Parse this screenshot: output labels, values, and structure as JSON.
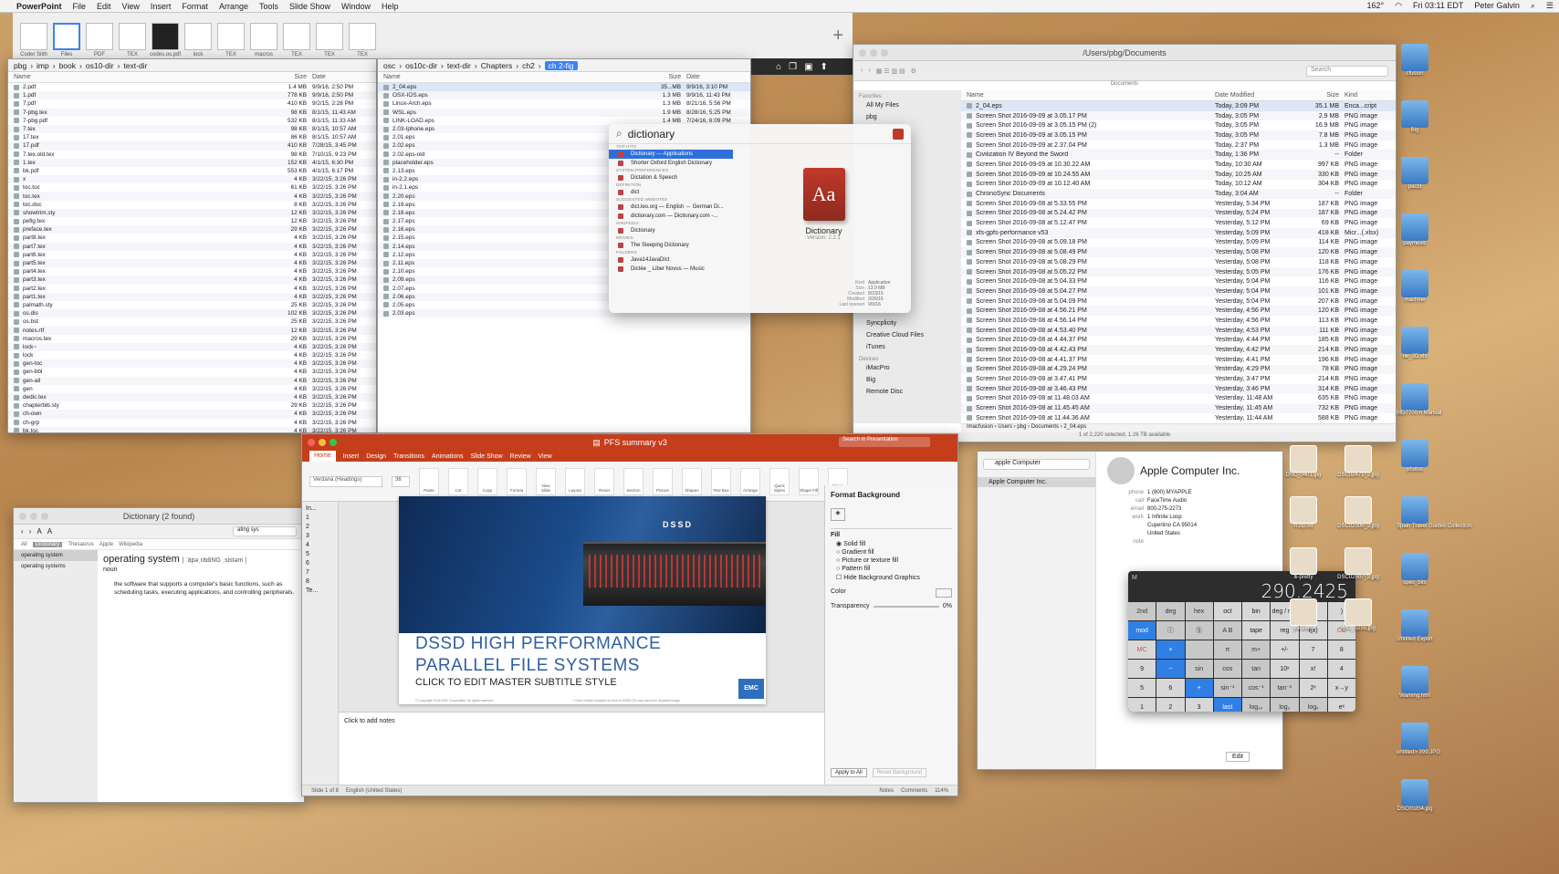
{
  "menubar": {
    "app": "PowerPoint",
    "items": [
      "File",
      "Edit",
      "View",
      "Insert",
      "Format",
      "Arrange",
      "Tools",
      "Slide Show",
      "Window",
      "Help"
    ],
    "status": "162°",
    "clock": "Fri 03:11 EDT",
    "user": "Peter Galvin"
  },
  "thumbs": [
    {
      "label": "Coder Slith",
      "cls": ""
    },
    {
      "label": "Files",
      "cls": "sel"
    },
    {
      "label": "PDF",
      "cls": ""
    },
    {
      "label": "TEX",
      "cls": ""
    },
    {
      "label": "codes.os.pdf",
      "cls": "dark"
    },
    {
      "label": "lock",
      "cls": ""
    },
    {
      "label": "TEX",
      "cls": ""
    },
    {
      "label": "macros",
      "cls": ""
    },
    {
      "label": "TEX",
      "cls": ""
    },
    {
      "label": "TEX",
      "cls": ""
    },
    {
      "label": "TEX",
      "cls": ""
    }
  ],
  "finder_left": {
    "path": [
      "pbg",
      "imp",
      "book",
      "os10-dir",
      "text-dir"
    ],
    "cols": {
      "name": "Name",
      "size": "Size",
      "date": "Date"
    },
    "rows": [
      [
        "2.pdf",
        "1.4 MB",
        "9/9/16, 2:50 PM"
      ],
      [
        "1.pdf",
        "778 KB",
        "9/9/16, 2:50 PM"
      ],
      [
        "7.pdf",
        "410 KB",
        "9/2/15, 2:28 PM"
      ],
      [
        "7-pbg.tex",
        "98 KB",
        "8/1/15, 11:43 AM"
      ],
      [
        "7-pbg.pdf",
        "532 KB",
        "8/1/15, 11:33 AM"
      ],
      [
        "7.tex",
        "98 KB",
        "8/1/15, 10:57 AM"
      ],
      [
        "17.tex",
        "86 KB",
        "8/1/15, 10:57 AM"
      ],
      [
        "17.pdf",
        "410 KB",
        "7/28/15, 3:45 PM"
      ],
      [
        "7.tex.old.tex",
        "98 KB",
        "7/10/15, 9:23 PM"
      ],
      [
        "1.tex",
        "152 KB",
        "4/1/15, 6:30 PM"
      ],
      [
        "bk.pdf",
        "553 KB",
        "4/1/15, 6:17 PM"
      ],
      [
        "x",
        "4 KB",
        "3/22/15, 3:26 PM"
      ],
      [
        "toc.toc",
        "61 KB",
        "3/22/15, 3:26 PM"
      ],
      [
        "toc.tex",
        "4 KB",
        "3/22/15, 3:26 PM"
      ],
      [
        "toc.doc",
        "8 KB",
        "3/22/15, 3:26 PM"
      ],
      [
        "showtrim.sty",
        "12 KB",
        "3/22/15, 3:26 PM"
      ],
      [
        "pefig.tex",
        "12 KB",
        "3/22/15, 3:26 PM"
      ],
      [
        "preface.tex",
        "29 KB",
        "3/22/15, 3:26 PM"
      ],
      [
        "part8.tex",
        "4 KB",
        "3/22/15, 3:26 PM"
      ],
      [
        "part7.tex",
        "4 KB",
        "3/22/15, 3:26 PM"
      ],
      [
        "part6.tex",
        "4 KB",
        "3/22/15, 3:26 PM"
      ],
      [
        "part5.tex",
        "4 KB",
        "3/22/15, 3:26 PM"
      ],
      [
        "part4.tex",
        "4 KB",
        "3/22/15, 3:26 PM"
      ],
      [
        "part3.tex",
        "4 KB",
        "3/22/15, 3:26 PM"
      ],
      [
        "part2.tex",
        "4 KB",
        "3/22/15, 3:26 PM"
      ],
      [
        "part1.tex",
        "4 KB",
        "3/22/15, 3:26 PM"
      ],
      [
        "palmath.sty",
        "25 KB",
        "3/22/15, 3:26 PM"
      ],
      [
        "os.dis",
        "102 KB",
        "3/22/15, 3:26 PM"
      ],
      [
        "os.bst",
        "25 KB",
        "3/22/15, 3:26 PM"
      ],
      [
        "notes.rtf",
        "12 KB",
        "3/22/15, 3:26 PM"
      ],
      [
        "macros.tex",
        "29 KB",
        "3/22/15, 3:26 PM"
      ],
      [
        "lock~",
        "4 KB",
        "3/22/15, 3:26 PM"
      ],
      [
        "lock",
        "4 KB",
        "3/22/15, 3:26 PM"
      ],
      [
        "gen-toc",
        "4 KB",
        "3/22/15, 3:26 PM"
      ],
      [
        "gen-bbl",
        "4 KB",
        "3/22/15, 3:26 PM"
      ],
      [
        "gen-all",
        "4 KB",
        "3/22/15, 3:26 PM"
      ],
      [
        "gen",
        "4 KB",
        "3/22/15, 3:26 PM"
      ],
      [
        "dedic.tex",
        "4 KB",
        "3/22/15, 3:26 PM"
      ],
      [
        "chapterbib.sty",
        "29 KB",
        "3/22/15, 3:26 PM"
      ],
      [
        "ch-own",
        "4 KB",
        "3/22/15, 3:26 PM"
      ],
      [
        "ch-grp",
        "4 KB",
        "3/22/15, 3:26 PM"
      ],
      [
        "bk.toc",
        "4 KB",
        "3/22/15, 3:26 PM"
      ],
      [
        "bk.tex",
        "86 KB",
        "3/22/15, 3:26 PM"
      ]
    ]
  },
  "finder_mid": {
    "path": [
      "osc",
      "os10c-dir",
      "text-dir",
      "Chapters",
      "ch2",
      "ch 2-fig"
    ],
    "cols": {
      "name": "Name",
      "size": "Size",
      "date": "Date"
    },
    "rows": [
      [
        "2_04.eps",
        "35...MB",
        "9/9/16, 3:10 PM"
      ],
      [
        "OSX-IOS.eps",
        "1.3 MB",
        "9/9/16, 11:43 PM"
      ],
      [
        "Linux-Arch.eps",
        "1.3 MB",
        "8/21/16, 5:56 PM"
      ],
      [
        "WSL.eps",
        "1.9 MB",
        "8/28/16, 5:25 PM"
      ],
      [
        "LINK-LOAD.eps",
        "1.4 MB",
        "7/24/16, 6:09 PM"
      ],
      [
        "2.03-Iphone.eps",
        "",
        ""
      ],
      [
        "2.01.eps",
        "",
        ""
      ],
      [
        "2.02.eps",
        "",
        ""
      ],
      [
        "2.02.eps-old",
        "",
        ""
      ],
      [
        "placeholder.eps",
        "",
        ""
      ],
      [
        "2.13.eps",
        "",
        ""
      ],
      [
        "in-2.2.eps",
        "",
        ""
      ],
      [
        "in-2.1.eps",
        "",
        ""
      ],
      [
        "2.20.eps",
        "",
        ""
      ],
      [
        "2.19.eps",
        "",
        ""
      ],
      [
        "2.18.eps",
        "",
        ""
      ],
      [
        "2.17.eps",
        "",
        ""
      ],
      [
        "2.16.eps",
        "",
        ""
      ],
      [
        "2.15.eps",
        "",
        ""
      ],
      [
        "2.14.eps",
        "",
        ""
      ],
      [
        "2.12.eps",
        "",
        ""
      ],
      [
        "2.11.eps",
        "",
        ""
      ],
      [
        "2.10.eps",
        "",
        ""
      ],
      [
        "2.09.eps",
        "",
        ""
      ],
      [
        "2.07.eps",
        "",
        ""
      ],
      [
        "2.06.eps",
        "",
        ""
      ],
      [
        "2.05.eps",
        "",
        ""
      ],
      [
        "2.03.eps",
        "",
        ""
      ]
    ]
  },
  "spotlight": {
    "query": "dictionary",
    "sections": [
      {
        "title": "Top Hits",
        "items": [
          "Dictionary — Applications",
          "Shorter Oxford English Dictionary"
        ]
      },
      {
        "title": "System Preferences",
        "items": [
          "Dictation & Speech"
        ]
      },
      {
        "title": "Definition",
        "items": [
          "dict"
        ]
      },
      {
        "title": "Suggested Websites",
        "items": [
          "dict.leo.org — English ⇔ German Di...",
          "dictionary.com — Dictionary.com -..."
        ]
      },
      {
        "title": "Wikipedia",
        "items": [
          "Dictionary"
        ]
      },
      {
        "title": "Movies",
        "items": [
          "The Sleeping Dictionary"
        ]
      },
      {
        "title": "Folders",
        "items": [
          "Java14JavaDict",
          "Dictée _ Liber Novus — Music"
        ]
      }
    ],
    "preview": {
      "icon_text": "Aa",
      "name": "Dictionary",
      "version": "Version: 2.2.1",
      "meta": [
        [
          "Kind",
          "Application"
        ],
        [
          "Size",
          "13.9 MB"
        ],
        [
          "Created",
          "8/23/15"
        ],
        [
          "Modified",
          "3/26/16"
        ],
        [
          "Last opened",
          "9/9/16"
        ]
      ]
    }
  },
  "finder_right": {
    "title": "/Users/pbg/Documents",
    "header": "Documents",
    "search_placeholder": "Search",
    "sidebar": {
      "favorites_title": "Favorites",
      "favorites": [
        "All My Files",
        "pbg"
      ],
      "more": [
        "os10-dir",
        "Syncplicity",
        "Creative Cloud Files",
        "iTunes"
      ],
      "devices_title": "Devices",
      "devices": [
        "iMacPro",
        "Big",
        "Remote Disc"
      ]
    },
    "cols": {
      "name": "Name",
      "date": "Date Modified",
      "size": "Size",
      "kind": "Kind"
    },
    "rows": [
      [
        "2_04.eps",
        "Today, 3:09 PM",
        "35.1 MB",
        "Enca...cript"
      ],
      [
        "Screen Shot 2016-09-09 at 3.05.17 PM",
        "Today, 3:05 PM",
        "2.9 MB",
        "PNG image"
      ],
      [
        "Screen Shot 2016-09-09 at 3.05.15 PM (2)",
        "Today, 3:05 PM",
        "16.9 MB",
        "PNG image"
      ],
      [
        "Screen Shot 2016-09-09 at 3.05.15 PM",
        "Today, 3:05 PM",
        "7.8 MB",
        "PNG image"
      ],
      [
        "Screen Shot 2016-09-09 at 2.37.04 PM",
        "Today, 2:37 PM",
        "1.3 MB",
        "PNG image"
      ],
      [
        "Civilization IV Beyond the Sword",
        "Today, 1:36 PM",
        "--",
        "Folder"
      ],
      [
        "Screen Shot 2016-09-09 at 10.30.22 AM",
        "Today, 10:30 AM",
        "997 KB",
        "PNG image"
      ],
      [
        "Screen Shot 2016-09-09 at 10.24.55 AM",
        "Today, 10:25 AM",
        "330 KB",
        "PNG image"
      ],
      [
        "Screen Shot 2016-09-09 at 10.12.40 AM",
        "Today, 10:12 AM",
        "304 KB",
        "PNG image"
      ],
      [
        "ChronoSync Documents",
        "Today, 3:04 AM",
        "--",
        "Folder"
      ],
      [
        "Screen Shot 2016-09-08 at 5.33.55 PM",
        "Yesterday, 5:34 PM",
        "187 KB",
        "PNG image"
      ],
      [
        "Screen Shot 2016-09-08 at 5.24.42 PM",
        "Yesterday, 5:24 PM",
        "187 KB",
        "PNG image"
      ],
      [
        "Screen Shot 2016-09-08 at 5.12.47 PM",
        "Yesterday, 5:12 PM",
        "69 KB",
        "PNG image"
      ],
      [
        "xfs-gpfs-performance v53",
        "Yesterday, 5:09 PM",
        "418 KB",
        "Micr...(.xlsx)"
      ],
      [
        "Screen Shot 2016-09-08 at 5.09.18 PM",
        "Yesterday, 5:09 PM",
        "114 KB",
        "PNG image"
      ],
      [
        "Screen Shot 2016-09-08 at 5.08.49 PM",
        "Yesterday, 5:08 PM",
        "120 KB",
        "PNG image"
      ],
      [
        "Screen Shot 2016-09-08 at 5.08.29 PM",
        "Yesterday, 5:08 PM",
        "118 KB",
        "PNG image"
      ],
      [
        "Screen Shot 2016-09-08 at 5.05.22 PM",
        "Yesterday, 5:05 PM",
        "176 KB",
        "PNG image"
      ],
      [
        "Screen Shot 2016-09-08 at 5.04.33 PM",
        "Yesterday, 5:04 PM",
        "116 KB",
        "PNG image"
      ],
      [
        "Screen Shot 2016-09-08 at 5.04.27 PM",
        "Yesterday, 5:04 PM",
        "101 KB",
        "PNG image"
      ],
      [
        "Screen Shot 2016-09-08 at 5.04.09 PM",
        "Yesterday, 5:04 PM",
        "207 KB",
        "PNG image"
      ],
      [
        "Screen Shot 2016-09-08 at 4.56.21 PM",
        "Yesterday, 4:56 PM",
        "120 KB",
        "PNG image"
      ],
      [
        "Screen Shot 2016-09-08 at 4.56.14 PM",
        "Yesterday, 4:56 PM",
        "113 KB",
        "PNG image"
      ],
      [
        "Screen Shot 2016-09-08 at 4.53.40 PM",
        "Yesterday, 4:53 PM",
        "111 KB",
        "PNG image"
      ],
      [
        "Screen Shot 2016-09-08 at 4.44.37 PM",
        "Yesterday, 4:44 PM",
        "185 KB",
        "PNG image"
      ],
      [
        "Screen Shot 2016-09-08 at 4.42.43 PM",
        "Yesterday, 4:42 PM",
        "214 KB",
        "PNG image"
      ],
      [
        "Screen Shot 2016-09-08 at 4.41.37 PM",
        "Yesterday, 4:41 PM",
        "196 KB",
        "PNG image"
      ],
      [
        "Screen Shot 2016-09-08 at 4.29.24 PM",
        "Yesterday, 4:29 PM",
        "78 KB",
        "PNG image"
      ],
      [
        "Screen Shot 2016-09-08 at 3.47.41 PM",
        "Yesterday, 3:47 PM",
        "214 KB",
        "PNG image"
      ],
      [
        "Screen Shot 2016-09-08 at 3.46.43 PM",
        "Yesterday, 3:46 PM",
        "314 KB",
        "PNG image"
      ],
      [
        "Screen Shot 2016-09-08 at 11.48.03 AM",
        "Yesterday, 11:48 AM",
        "635 KB",
        "PNG image"
      ],
      [
        "Screen Shot 2016-09-08 at 11.45.45 AM",
        "Yesterday, 11:45 AM",
        "732 KB",
        "PNG image"
      ],
      [
        "Screen Shot 2016-09-08 at 11.44.36 AM",
        "Yesterday, 11:44 AM",
        "588 KB",
        "PNG image"
      ]
    ],
    "status": "1 of 2,220 selected, 1.26 TB available",
    "pathfoot": "Imacfusion › Users › pbg › Documents › 2_04.eps"
  },
  "dictionary": {
    "title": "Dictionary (2 found)",
    "search_value": "ating sys",
    "source_tabs": [
      "All",
      "Dictionary",
      "Thesaurus",
      "Apple",
      "Wikipedia"
    ],
    "results": [
      "operating system",
      "operating systems"
    ],
    "entry_word": "operating system",
    "entry_pron": "| ˈäpəˌrādiNG ˌsistəm |",
    "entry_pos": "noun",
    "entry_def": "the software that supports a computer's basic functions, such as scheduling tasks, executing applications, and controlling peripherals."
  },
  "powerpoint": {
    "title": "PFS summary v3",
    "search_placeholder": "Search in Presentation",
    "tabs": [
      "Home",
      "Insert",
      "Design",
      "Transitions",
      "Animations",
      "Slide Show",
      "Review",
      "View"
    ],
    "ribbon": [
      "Paste",
      "Cut",
      "Copy",
      "Format",
      "New Slide",
      "Layout",
      "Reset",
      "Section",
      "Picture",
      "Shapes",
      "Text Box",
      "Arrange",
      "Quick Styles",
      "Shape Fill",
      "Shape Outline"
    ],
    "font_name": "Verdana (Headings)",
    "font_size": "36",
    "slide": {
      "logo": "DSSD",
      "title_line1": "DSSD HIGH PERFORMANCE",
      "title_line2": "PARALLEL FILE SYSTEMS",
      "subtitle": "CLICK TO EDIT MASTER SUBTITLE STYLE",
      "badge": "EMC",
      "footer": "© Copyright 2016 EMC Corporation. All rights reserved.",
      "footnote": "* Color of flash modules on front of DSSD D5 may vary from depicted image."
    },
    "outline_title": "In...",
    "outline_title2": "Te...",
    "notes_placeholder": "Click to add notes",
    "statusbar": {
      "slide": "Slide 1 of 8",
      "lang": "English (United States)",
      "notes": "Notes",
      "comments": "Comments",
      "zoom": "114%"
    },
    "format_panel": {
      "title": "Format Background",
      "section": "Fill",
      "options": [
        "Solid fill",
        "Gradient fill",
        "Picture or texture fill",
        "Pattern fill"
      ],
      "checkbox": "Hide Background Graphics",
      "color_label": "Color",
      "transparency_label": "Transparency",
      "transparency_value": "0%",
      "apply_all": "Apply to All",
      "reset": "Reset Background"
    }
  },
  "contacts": {
    "search_value": "apple Computer",
    "list": [
      "Apple Computer Inc."
    ],
    "name": "Apple Computer Inc.",
    "fields": [
      [
        "phone",
        "1 (800) MYAPPLE"
      ],
      [
        "call",
        "FaceTime   Audio"
      ],
      [
        "email",
        "800-275-2273"
      ],
      [
        "work",
        "1 Infinite Loop"
      ],
      [
        "",
        "Cupertino CA 95014"
      ],
      [
        "",
        "United States"
      ],
      [
        "note",
        ""
      ]
    ],
    "edit": "Edit"
  },
  "calculator": {
    "display": "290.2425",
    "mode": "M",
    "keys": [
      [
        "2nd",
        "deg",
        "hex",
        "oct",
        "bin",
        "deg / rad",
        "(",
        ")",
        "mod"
      ],
      [
        "ⓘ",
        "Ⓢ",
        "A B",
        "tape",
        "reg",
        "f(x)",
        "CC",
        "MC",
        "×"
      ],
      [
        "",
        "π",
        "m+",
        "+/-",
        "7",
        "8",
        "9",
        "−"
      ],
      [
        "sin",
        "cos",
        "tan",
        "10ˣ",
        "x!",
        "4",
        "5",
        "6",
        "+"
      ],
      [
        "sin⁻¹",
        "cos⁻¹",
        "tan⁻¹",
        "2ˣ",
        "x→y",
        "1",
        "2",
        "3",
        "last"
      ],
      [
        "log₁₀",
        "log₂",
        "logₓ",
        "eˣ",
        "x→m",
        "0",
        "frac",
        "exp"
      ]
    ]
  },
  "desktop": {
    "right_col": [
      "cfusion",
      "Big",
      "pacbt",
      "paymusic",
      "machine",
      "ne_3D.xls",
      "MG7700 n Manual",
      "photos",
      "Spain Travel Guides Collection",
      "spec_bits",
      "Untitled Export",
      "Warning.htm",
      "untitled> 399.JPG",
      "DSC00204.jpg"
    ],
    "mid_col": [
      "DSC_0401.jpg",
      "DSC02471_2.jpg",
      "rr.zip.txt",
      "DSC02506_2.jpg",
      "lli-pretty",
      "DSC02507_2.jpg",
      "ysc2key",
      "IMG_0255.jpg"
    ]
  }
}
